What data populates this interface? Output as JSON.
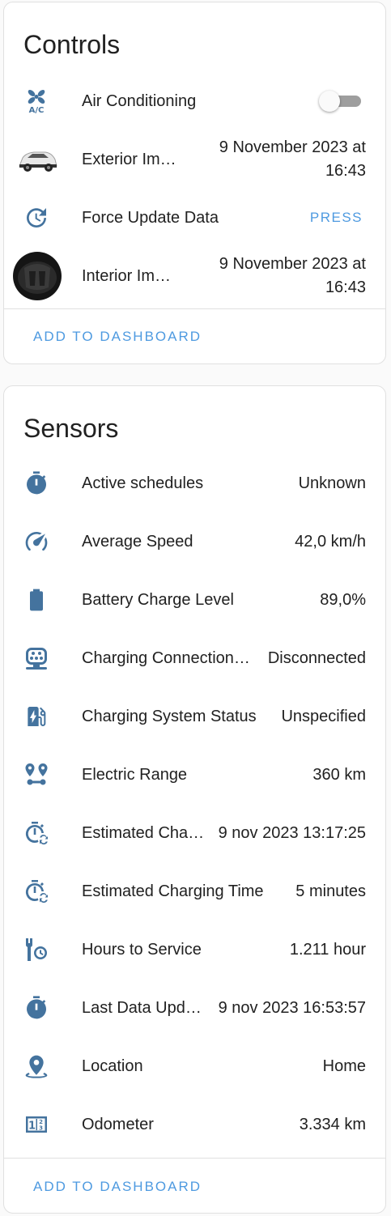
{
  "controls": {
    "title": "Controls",
    "rows": [
      {
        "name": "Air Conditioning",
        "icon": "air-conditioner-icon",
        "state": "off"
      },
      {
        "name": "Exterior Im…",
        "icon": "car-image",
        "value": "9 November 2023 at 16:43"
      },
      {
        "name": "Force Update Data",
        "icon": "update-icon",
        "action": "PRESS"
      },
      {
        "name": "Interior Im…",
        "icon": "car-interior-image",
        "value": "9 November 2023 at 16:43"
      }
    ],
    "add_to_dashboard": "ADD TO DASHBOARD"
  },
  "sensors": {
    "title": "Sensors",
    "rows": [
      {
        "name": "Active schedules",
        "icon": "timer-icon",
        "value": "Unknown"
      },
      {
        "name": "Average Speed",
        "icon": "speedometer-icon",
        "value": "42,0 km/h"
      },
      {
        "name": "Battery Charge Level",
        "icon": "battery-icon",
        "value": "89,0%"
      },
      {
        "name": "Charging Connection…",
        "icon": "ev-plug-icon",
        "value": "Disconnected"
      },
      {
        "name": "Charging System Status",
        "icon": "ev-station-icon",
        "value": "Unspecified"
      },
      {
        "name": "Electric Range",
        "icon": "map-marker-distance-icon",
        "value": "360 km"
      },
      {
        "name": "Estimated Cha…",
        "icon": "timer-sync-icon",
        "value": "9 nov 2023 13:17:25"
      },
      {
        "name": "Estimated Charging Time",
        "icon": "timer-sync-icon",
        "value": "5 minutes"
      },
      {
        "name": "Hours to Service",
        "icon": "wrench-clock-icon",
        "value": "1.211 hour"
      },
      {
        "name": "Last Data Upd…",
        "icon": "timer-icon",
        "value": "9 nov 2023 16:53:57"
      },
      {
        "name": "Location",
        "icon": "map-marker-icon",
        "value": "Home"
      },
      {
        "name": "Odometer",
        "icon": "counter-icon",
        "value": "3.334 km"
      }
    ],
    "add_to_dashboard": "ADD TO DASHBOARD"
  },
  "colors": {
    "icon": "#44739e",
    "accent": "#4e9ae0",
    "toggle_track": "#9e9e9e"
  }
}
